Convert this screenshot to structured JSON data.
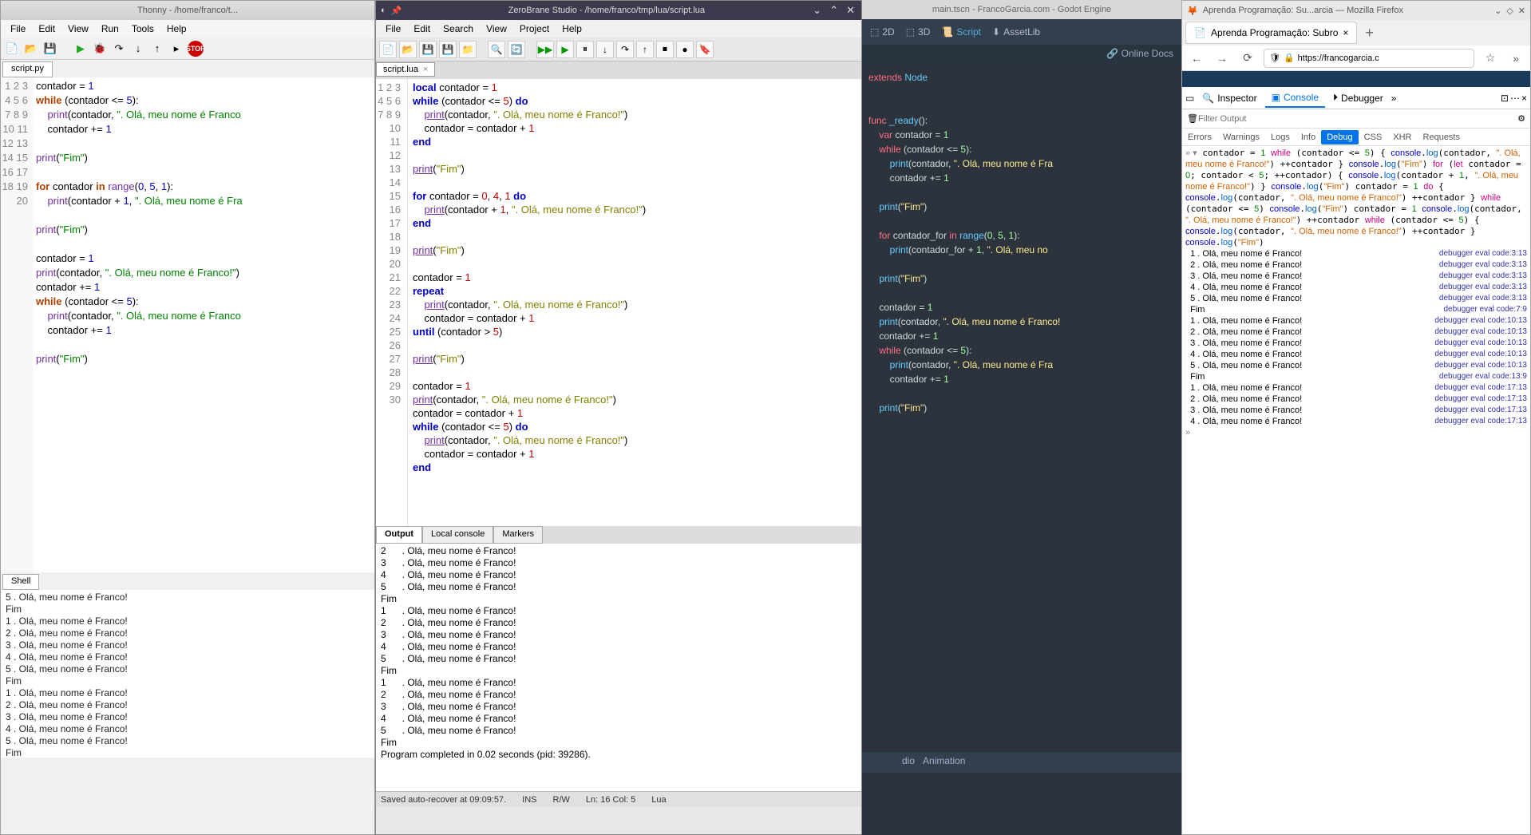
{
  "thonny": {
    "title": "Thonny - /home/franco/t...",
    "menu": [
      "File",
      "Edit",
      "View",
      "Run",
      "Tools",
      "Help"
    ],
    "tab": "script.py",
    "lines": [
      "1",
      "2",
      "3",
      "4",
      "5",
      "6",
      "7",
      "8",
      "9",
      "10",
      "11",
      "12",
      "13",
      "14",
      "15",
      "16",
      "17",
      "18",
      "19",
      "20"
    ],
    "shell_tab": "Shell",
    "shell_output": [
      "5 . Olá, meu nome é Franco!",
      "Fim",
      "1 . Olá, meu nome é Franco!",
      "2 . Olá, meu nome é Franco!",
      "3 . Olá, meu nome é Franco!",
      "4 . Olá, meu nome é Franco!",
      "5 . Olá, meu nome é Franco!",
      "Fim",
      "1 . Olá, meu nome é Franco!",
      "2 . Olá, meu nome é Franco!",
      "3 . Olá, meu nome é Franco!",
      "4 . Olá, meu nome é Franco!",
      "5 . Olá, meu nome é Franco!",
      "Fim"
    ],
    "prompt": ">>>"
  },
  "zerobrane": {
    "title": "ZeroBrane Studio - /home/franco/tmp/lua/script.lua",
    "menu": [
      "File",
      "Edit",
      "Search",
      "View",
      "Project",
      "Help"
    ],
    "tab": "script.lua",
    "lines": [
      "1",
      "2",
      "3",
      "4",
      "5",
      "6",
      "7",
      "8",
      "9",
      "10",
      "11",
      "12",
      "13",
      "14",
      "15",
      "16",
      "17",
      "18",
      "19",
      "20",
      "21",
      "22",
      "23",
      "24",
      "25",
      "26",
      "27",
      "28",
      "29",
      "30"
    ],
    "output_tabs": [
      "Output",
      "Local console",
      "Markers"
    ],
    "output": [
      "2      . Olá, meu nome é Franco!",
      "3      . Olá, meu nome é Franco!",
      "4      . Olá, meu nome é Franco!",
      "5      . Olá, meu nome é Franco!",
      "Fim",
      "1      . Olá, meu nome é Franco!",
      "2      . Olá, meu nome é Franco!",
      "3      . Olá, meu nome é Franco!",
      "4      . Olá, meu nome é Franco!",
      "5      . Olá, meu nome é Franco!",
      "Fim",
      "1      . Olá, meu nome é Franco!",
      "2      . Olá, meu nome é Franco!",
      "3      . Olá, meu nome é Franco!",
      "4      . Olá, meu nome é Franco!",
      "5      . Olá, meu nome é Franco!",
      "Fim",
      "Program completed in 0.02 seconds (pid: 39286)."
    ],
    "status": {
      "save": "Saved auto-recover at 09:09:57.",
      "ins": "INS",
      "rw": "R/W",
      "pos": "Ln: 16 Col: 5",
      "lang": "Lua"
    }
  },
  "godot": {
    "title": "main.tscn - FrancoGarcia.com - Godot Engine",
    "toolbar": {
      "2d": "2D",
      "3d": "3D",
      "script": "Script",
      "assetlib": "AssetLib"
    },
    "docs": "Online Docs",
    "bottom": "Animation"
  },
  "firefox": {
    "title": "Aprenda Programação: Su...arcia — Mozilla Firefox",
    "tab": "Aprenda Programação: Subro",
    "url": "https://francogarcia.c",
    "devtools": {
      "tabs": {
        "inspector": "Inspector",
        "console": "Console",
        "debugger": "Debugger"
      },
      "filter_placeholder": "Filter Output",
      "cats": [
        "Errors",
        "Warnings",
        "Logs",
        "Info",
        "Debug",
        "CSS",
        "XHR",
        "Requests"
      ],
      "output_rows": [
        {
          "l": "1 . Olá, meu nome é Franco!",
          "r": "debugger eval code:3:13"
        },
        {
          "l": "2 . Olá, meu nome é Franco!",
          "r": "debugger eval code:3:13"
        },
        {
          "l": "3 . Olá, meu nome é Franco!",
          "r": "debugger eval code:3:13"
        },
        {
          "l": "4 . Olá, meu nome é Franco!",
          "r": "debugger eval code:3:13"
        },
        {
          "l": "5 . Olá, meu nome é Franco!",
          "r": "debugger eval code:3:13"
        },
        {
          "l": "Fim",
          "r": "debugger eval code:7:9"
        },
        {
          "l": "1 . Olá, meu nome é Franco!",
          "r": "debugger eval code:10:13"
        },
        {
          "l": "2 . Olá, meu nome é Franco!",
          "r": "debugger eval code:10:13"
        },
        {
          "l": "3 . Olá, meu nome é Franco!",
          "r": "debugger eval code:10:13"
        },
        {
          "l": "4 . Olá, meu nome é Franco!",
          "r": "debugger eval code:10:13"
        },
        {
          "l": "5 . Olá, meu nome é Franco!",
          "r": "debugger eval code:10:13"
        },
        {
          "l": "Fim",
          "r": "debugger eval code:13:9"
        },
        {
          "l": "1 . Olá, meu nome é Franco!",
          "r": "debugger eval code:17:13"
        },
        {
          "l": "2 . Olá, meu nome é Franco!",
          "r": "debugger eval code:17:13"
        },
        {
          "l": "3 . Olá, meu nome é Franco!",
          "r": "debugger eval code:17:13"
        },
        {
          "l": "4 . Olá, meu nome é Franco!",
          "r": "debugger eval code:17:13"
        }
      ]
    }
  }
}
